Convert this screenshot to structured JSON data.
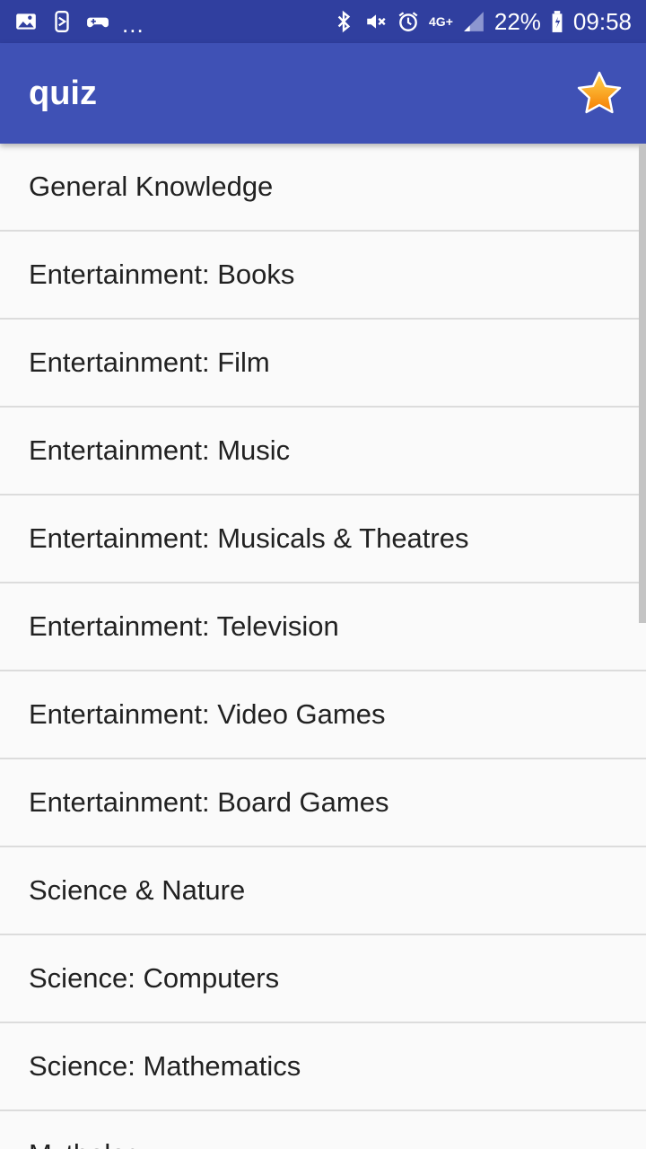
{
  "status_bar": {
    "overflow_dots": "...",
    "battery_percent": "22%",
    "time": "09:58",
    "network_type": "4G+",
    "left_icons": [
      "image-icon",
      "transfer-icon",
      "game-controller-icon"
    ],
    "right_icons": [
      "bluetooth-icon",
      "mute-icon",
      "alarm-icon",
      "signal-icon",
      "battery-icon"
    ]
  },
  "app_bar": {
    "title": "quiz",
    "action_icon": "star-icon"
  },
  "categories": [
    "General Knowledge",
    "Entertainment: Books",
    "Entertainment: Film",
    "Entertainment: Music",
    "Entertainment: Musicals & Theatres",
    "Entertainment: Television",
    "Entertainment: Video Games",
    "Entertainment: Board Games",
    "Science & Nature",
    "Science: Computers",
    "Science: Mathematics",
    "Mythology"
  ],
  "colors": {
    "status_bar": "#303f9f",
    "app_bar": "#3f51b5",
    "background": "#fafafa",
    "divider": "#dcdcdc",
    "text": "#212121",
    "star_fill": "#ffa000"
  }
}
